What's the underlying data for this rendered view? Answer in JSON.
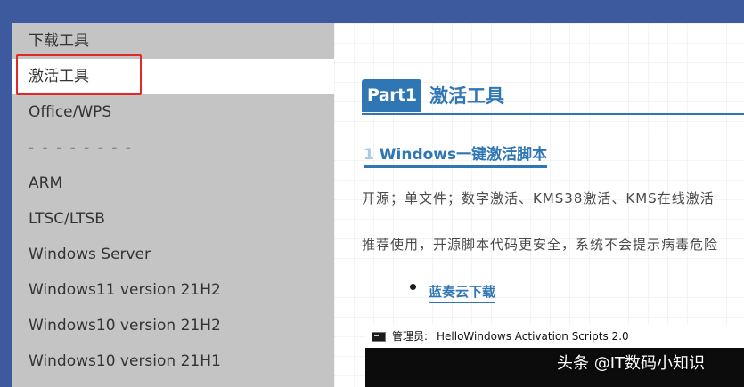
{
  "sidebar": {
    "items": [
      {
        "label": "下载工具",
        "active": false
      },
      {
        "label": "激活工具",
        "active": true
      },
      {
        "label": "Office/WPS",
        "active": false
      },
      {
        "label": "- - - - - - - -",
        "active": false
      },
      {
        "label": "ARM",
        "active": false
      },
      {
        "label": "LTSC/LTSB",
        "active": false
      },
      {
        "label": "Windows Server",
        "active": false
      },
      {
        "label": "Windows11 version 21H2",
        "active": false
      },
      {
        "label": "Windows10 version 21H2",
        "active": false
      },
      {
        "label": "Windows10 version 21H1",
        "active": false
      }
    ]
  },
  "article": {
    "part_badge": "Part1",
    "part_title": "激活工具",
    "section_number": "1",
    "section_title": "Windows一键激活脚本",
    "paragraph1": "开源；单文件；数字激活、KMS38激活、KMS在线激活",
    "paragraph2": "推荐使用，开源脚本代码更安全，系统不会提示病毒危险",
    "link_label": "蓝奏云下载"
  },
  "console": {
    "label": "管理员:",
    "title": "HelloWindows Activation Scripts 2.0"
  },
  "watermark": "头条 @IT数码小知识",
  "colors": {
    "accent": "#2f76b5",
    "highlight": "#e02a2a",
    "sidebar_bg": "#c4c4c4",
    "page_bg": "#3d5a9e"
  }
}
